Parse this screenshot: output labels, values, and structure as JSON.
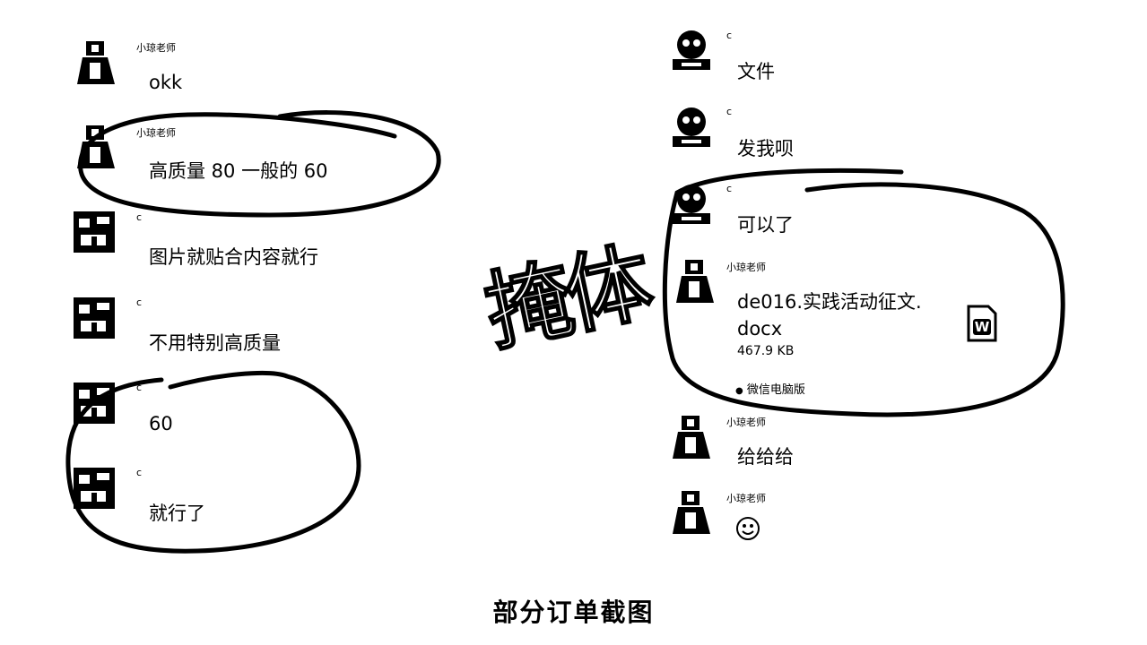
{
  "left_chat": [
    {
      "sender": "小琼老师",
      "text": "okk",
      "avatar": "teacher"
    },
    {
      "sender": "小琼老师",
      "text": "高质量 80 一般的 60",
      "avatar": "teacher"
    },
    {
      "sender": "c",
      "text": "图片就贴合内容就行",
      "avatar": "customer"
    },
    {
      "sender": "c",
      "text": "不用特别高质量",
      "avatar": "customer"
    },
    {
      "sender": "c",
      "text": "60",
      "avatar": "customer"
    },
    {
      "sender": "c",
      "text": "就行了",
      "avatar": "customer"
    }
  ],
  "right_chat": [
    {
      "sender": "c",
      "text": "文件",
      "avatar": "customer2"
    },
    {
      "sender": "c",
      "text": "发我呗",
      "avatar": "customer2"
    },
    {
      "sender": "c",
      "text": "可以了",
      "avatar": "customer2"
    }
  ],
  "file_message": {
    "sender": "小琼老师",
    "name_line1": "de016.实践活动征文.",
    "name_line2": "docx",
    "size": "467.9 KB",
    "source": "微信电脑版",
    "icon": "word-file-icon",
    "icon_letter": "W"
  },
  "right_chat_after": [
    {
      "sender": "小琼老师",
      "text": "给给给",
      "avatar": "teacher"
    },
    {
      "sender": "小琼老师",
      "text": "",
      "emoji": "smile-emoji-icon",
      "avatar": "teacher"
    }
  ],
  "watermark": "掩体",
  "caption": "部分订单截图"
}
